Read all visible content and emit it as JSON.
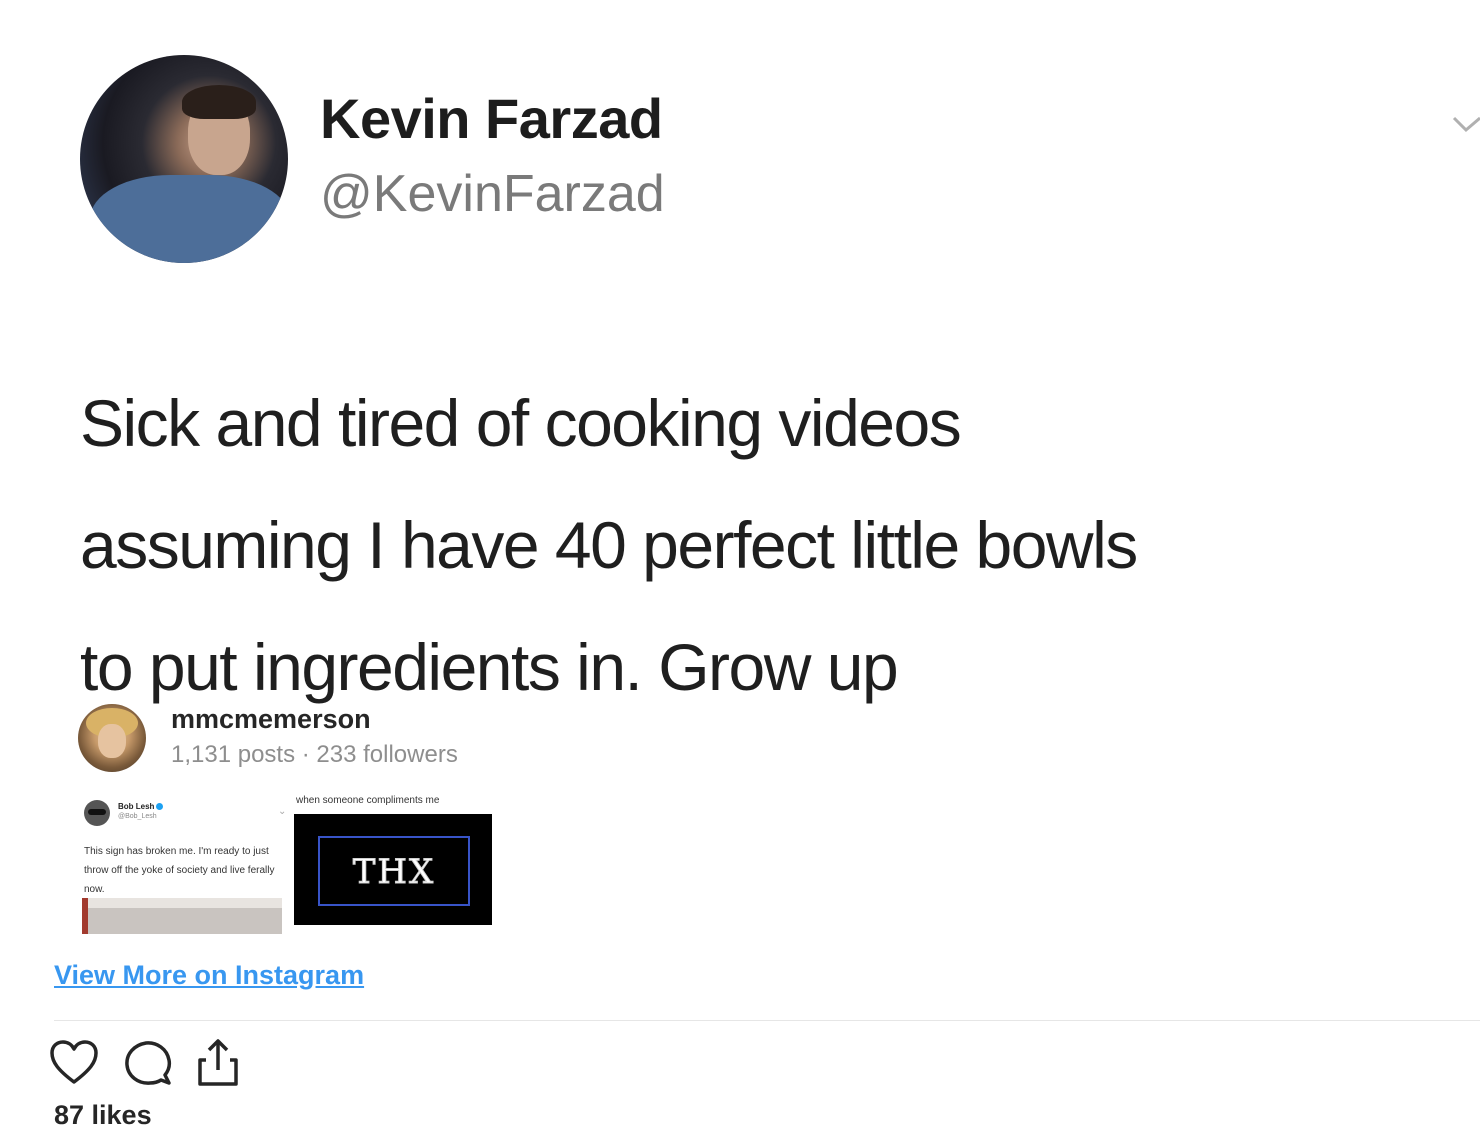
{
  "tweet": {
    "display_name": "Kevin Farzad",
    "handle": "@KevinFarzad",
    "lines": [
      "Sick and tired of cooking videos",
      "assuming I have 40 perfect little bowls",
      "to put ingredients in. Grow up"
    ]
  },
  "instagram": {
    "username": "mmcmemerson",
    "meta": "1,131 posts · 233 followers",
    "thumb1": {
      "name": "Bob Lesh",
      "handle": "@Bob_Lesh",
      "text": "This sign has broken me. I'm ready to just throw off the yoke of society and live ferally now."
    },
    "thumb2": {
      "caption": "when someone compliments me",
      "logo": "THX"
    },
    "view_more": "View More on Instagram",
    "likes": "87 likes"
  },
  "colors": {
    "link": "#3897f0",
    "muted": "#8e8e8e",
    "text": "#262626"
  }
}
